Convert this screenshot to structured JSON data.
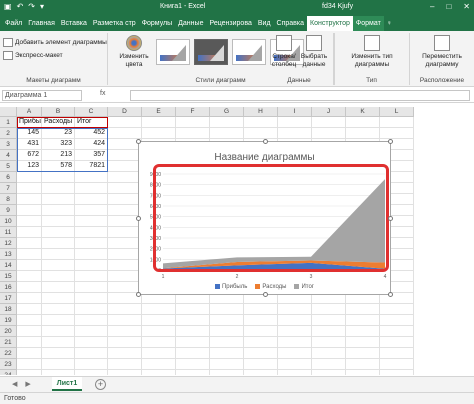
{
  "titlebar": {
    "title": "Книга1 - Excel",
    "user": "fd34 Kjufy",
    "minimize": "–",
    "restore": "□",
    "close": "✕"
  },
  "tabs": [
    {
      "label": "Файл",
      "state": "normal"
    },
    {
      "label": "Главная",
      "state": "normal"
    },
    {
      "label": "Вставка",
      "state": "normal"
    },
    {
      "label": "Разметка стр",
      "state": "normal"
    },
    {
      "label": "Формулы",
      "state": "normal"
    },
    {
      "label": "Данные",
      "state": "normal"
    },
    {
      "label": "Рецензирова",
      "state": "normal"
    },
    {
      "label": "Вид",
      "state": "normal"
    },
    {
      "label": "Справка",
      "state": "normal"
    },
    {
      "label": "Конструктор",
      "state": "active"
    },
    {
      "label": "Формат",
      "state": "context"
    }
  ],
  "ribbon": {
    "add_element": "Добавить элемент диаграммы",
    "express_layout": "Экспресс-макет",
    "group_layouts": "Макеты диаграмм",
    "change_colors": "Изменить цвета",
    "group_styles": "Стили диаграмм",
    "row_col": "Строка/ столбец",
    "select_data": "Выбрать данные",
    "group_data": "Данные",
    "change_type": "Изменить тип диаграммы",
    "group_type": "Тип",
    "move_chart": "Переместить диаграмму",
    "group_location": "Расположение"
  },
  "formulabar": {
    "namebox": "Диаграмма 1",
    "fx": "fx"
  },
  "columns": [
    "A",
    "B",
    "C",
    "D",
    "E",
    "F",
    "G",
    "H",
    "I",
    "J",
    "K",
    "L"
  ],
  "rows": [
    "1",
    "2",
    "3",
    "4",
    "5",
    "6",
    "7",
    "8",
    "9",
    "10",
    "11",
    "12",
    "13",
    "14",
    "15",
    "16",
    "17",
    "18",
    "19",
    "20",
    "21",
    "22",
    "23",
    "24"
  ],
  "table": {
    "headers": [
      "Прибыль",
      "Расходы",
      "Итог"
    ],
    "rows": [
      [
        "145",
        "23",
        "452"
      ],
      [
        "431",
        "323",
        "424"
      ],
      [
        "672",
        "213",
        "357"
      ],
      [
        "123",
        "578",
        "7821"
      ]
    ]
  },
  "chart_data": {
    "type": "area",
    "title": "Название диаграммы",
    "x": [
      "1",
      "2",
      "3",
      "4"
    ],
    "series": [
      {
        "name": "Прибыль",
        "values": [
          145,
          431,
          672,
          123
        ],
        "color": "#4472c4"
      },
      {
        "name": "Расходы",
        "values": [
          23,
          323,
          213,
          578
        ],
        "color": "#ed7d31"
      },
      {
        "name": "Итог",
        "values": [
          452,
          424,
          357,
          7821
        ],
        "color": "#a5a5a5"
      }
    ],
    "stacked": true,
    "yticks": [
      "0",
      "1000",
      "2000",
      "3000",
      "4000",
      "5000",
      "6000",
      "7000",
      "8000",
      "9000"
    ],
    "ylim": [
      0,
      9000
    ],
    "grid": true,
    "legend": "bottom"
  },
  "sheets": {
    "active": "Лист1",
    "prev": "◀",
    "next": "▶",
    "add": "+"
  },
  "status": {
    "ready": "Готово"
  }
}
